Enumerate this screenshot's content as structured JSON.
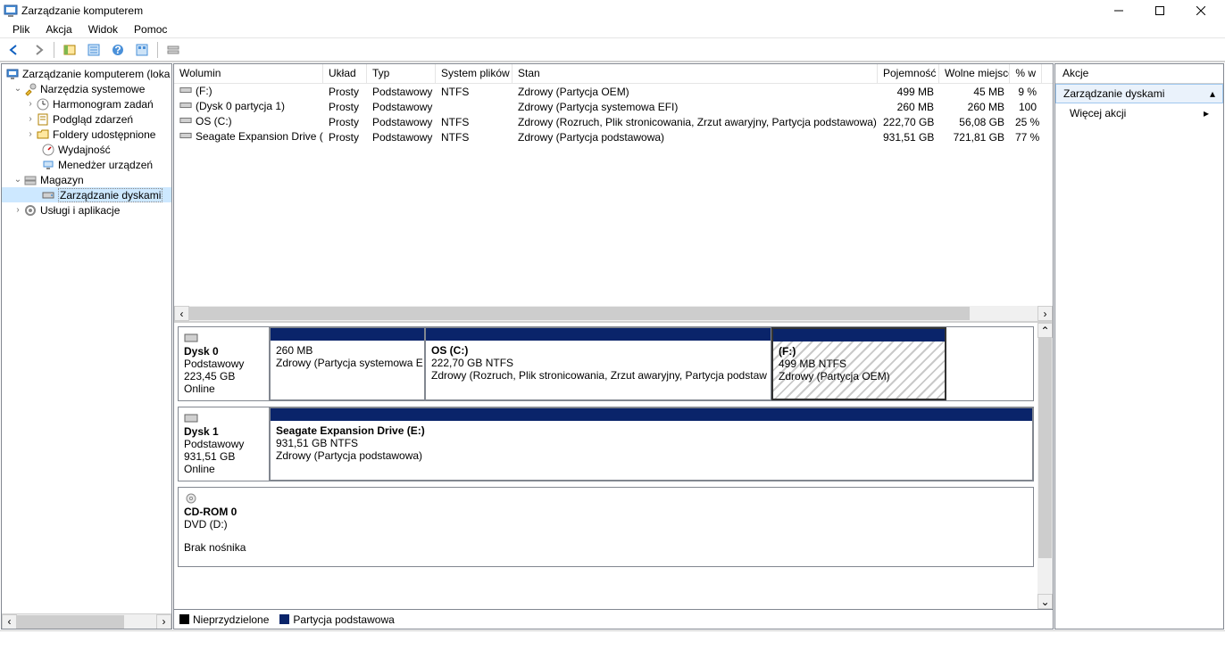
{
  "window": {
    "title": "Zarządzanie komputerem"
  },
  "menu": {
    "file": "Plik",
    "action": "Akcja",
    "view": "Widok",
    "help": "Pomoc"
  },
  "tree": {
    "root": "Zarządzanie komputerem (loka",
    "systools": "Narzędzia systemowe",
    "scheduler": "Harmonogram zadań",
    "eventviewer": "Podgląd zdarzeń",
    "shared": "Foldery udostępnione",
    "perf": "Wydajność",
    "devmgr": "Menedżer urządzeń",
    "storage": "Magazyn",
    "diskmgmt": "Zarządzanie dyskami",
    "services": "Usługi i aplikacje"
  },
  "grid": {
    "headers": {
      "volume": "Wolumin",
      "layout": "Układ",
      "type": "Typ",
      "fs": "System plików",
      "status": "Stan",
      "capacity": "Pojemność",
      "free": "Wolne miejsce",
      "pct": "% w"
    },
    "rows": [
      {
        "vol": "(F:)",
        "layout": "Prosty",
        "type": "Podstawowy",
        "fs": "NTFS",
        "status": "Zdrowy (Partycja OEM)",
        "cap": "499 MB",
        "free": "45 MB",
        "pct": "9 %"
      },
      {
        "vol": "(Dysk 0 partycja 1)",
        "layout": "Prosty",
        "type": "Podstawowy",
        "fs": "",
        "status": "Zdrowy (Partycja systemowa EFI)",
        "cap": "260 MB",
        "free": "260 MB",
        "pct": "100"
      },
      {
        "vol": "OS (C:)",
        "layout": "Prosty",
        "type": "Podstawowy",
        "fs": "NTFS",
        "status": "Zdrowy (Rozruch, Plik stronicowania, Zrzut awaryjny, Partycja podstawowa)",
        "cap": "222,70 GB",
        "free": "56,08 GB",
        "pct": "25 %"
      },
      {
        "vol": "Seagate Expansion Drive (E:)",
        "layout": "Prosty",
        "type": "Podstawowy",
        "fs": "NTFS",
        "status": "Zdrowy (Partycja podstawowa)",
        "cap": "931,51 GB",
        "free": "721,81 GB",
        "pct": "77 %"
      }
    ]
  },
  "disks": {
    "d0": {
      "name": "Dysk 0",
      "type": "Podstawowy",
      "size": "223,45 GB",
      "state": "Online",
      "p1": {
        "name": "",
        "size": "260 MB",
        "status": "Zdrowy (Partycja systemowa E"
      },
      "p2": {
        "name": "OS  (C:)",
        "size": "222,70 GB NTFS",
        "status": "Zdrowy (Rozruch, Plik stronicowania, Zrzut awaryjny, Partycja podstaw"
      },
      "p3": {
        "name": "(F:)",
        "size": "499 MB NTFS",
        "status": "Zdrowy (Partycja OEM)"
      }
    },
    "d1": {
      "name": "Dysk 1",
      "type": "Podstawowy",
      "size": "931,51 GB",
      "state": "Online",
      "p1": {
        "name": "Seagate Expansion Drive  (E:)",
        "size": "931,51 GB NTFS",
        "status": "Zdrowy (Partycja podstawowa)"
      }
    },
    "cd": {
      "name": "CD-ROM 0",
      "type": "DVD (D:)",
      "state": "Brak nośnika"
    }
  },
  "legend": {
    "unalloc": "Nieprzydzielone",
    "primary": "Partycja podstawowa"
  },
  "actions": {
    "header": "Akcje",
    "group": "Zarządzanie dyskami",
    "more": "Więcej akcji"
  }
}
